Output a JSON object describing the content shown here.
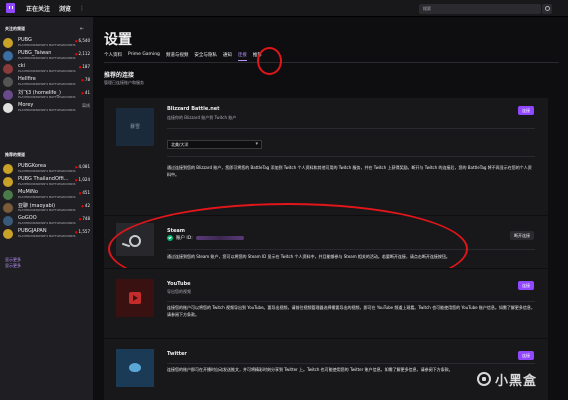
{
  "topbar": {
    "nav": [
      "正在关注",
      "浏览"
    ],
    "more_icon": "more-icon",
    "search_placeholder": "搜索"
  },
  "sidebar": {
    "followed_heading": "关注的频道",
    "recommended_heading": "推荐的频道",
    "followed": [
      {
        "name": "PUBG",
        "game": "PLAYERUNKNOWN'S BATTLEGROUNDS",
        "viewers": "6,540",
        "live": true,
        "color": "#c9a227"
      },
      {
        "name": "PUBG_Taiwan",
        "game": "PLAYERUNKNOWN'S BATTLEGROUNDS",
        "viewers": "2,112",
        "live": true,
        "color": "#3a6ea5"
      },
      {
        "name": "cki",
        "game": "PLAYERUNKNOWN'S BATTLEGROUNDS",
        "viewers": "187",
        "live": true,
        "color": "#8a3a3a"
      },
      {
        "name": "Hellfire",
        "game": "PLAYERUNKNOWN'S BATTLEGROUNDS",
        "viewers": "78",
        "live": true,
        "color": "#555555"
      },
      {
        "name": "刘飞3 (homelife_)",
        "game": "PLAYERUNKNOWN'S BATTLEGROUNDS",
        "viewers": "41",
        "live": true,
        "color": "#6a4a8a"
      },
      {
        "name": "Morey",
        "game": "PLAYERUNKNOWN'S BATTLEGROUNDS",
        "viewers": "离线",
        "live": false,
        "color": "#e0e0e0"
      }
    ],
    "recommended": [
      {
        "name": "PUBGKorea",
        "game": "PLAYERUNKNOWN'S BATTLEGROUNDS",
        "viewers": "4,081",
        "live": true,
        "color": "#c9a227"
      },
      {
        "name": "PUBG ThailandOffi...",
        "game": "PLAYERUNKNOWN'S BATTLEGROUNDS",
        "viewers": "1,024",
        "live": true,
        "color": "#c9a227"
      },
      {
        "name": "MuMiNo",
        "game": "PLAYERUNKNOWN'S BATTLEGROUNDS",
        "viewers": "451",
        "live": true,
        "color": "#4a7a4a"
      },
      {
        "name": "亚聊 (maoyabi)",
        "game": "PLAYERUNKNOWN'S BATTLEGROUNDS",
        "viewers": "42",
        "live": true,
        "color": "#7a5a3a"
      },
      {
        "name": "GoGOO",
        "game": "PLAYERUNKNOWN'S BATTLEGROUNDS",
        "viewers": "748",
        "live": true,
        "color": "#3a5a7a"
      },
      {
        "name": "PUBGJAPAN",
        "game": "PLAYERUNKNOWN'S BATTLEGROUNDS",
        "viewers": "1,557",
        "live": true,
        "color": "#c9a227"
      }
    ],
    "show_more": "显示更多",
    "show_more_2": "显示更多"
  },
  "main": {
    "title": "设置",
    "tabs": [
      "个人资料",
      "Prime Gaming",
      "频道与视频",
      "安全与隐私",
      "通知",
      "连接",
      "推荐"
    ],
    "active_tab_index": 5,
    "section_title": "推荐的连接",
    "section_sub": "管理已连接账户和服务",
    "cards": {
      "battlenet": {
        "logo_text": "暴雪",
        "title": "Blizzard Battle.net",
        "desc": "连接你的 Blizzard 账户到 Twitch 账户",
        "button": "连接",
        "region": "北美/大洋",
        "body": "通过连接到您的 Blizzard 账户，您即可将您的 BattleTag 添加到 Twitch 个人资料和其他可用的 Twitch 服务，并在 Twitch 上获得奖励。断开与 Twitch 的连接后，您的 BattleTag 将不再显示在您的个人资料中。"
      },
      "steam": {
        "title": "Steam",
        "status": "账户 ID:",
        "button": "断开连接",
        "body": "通过连接到您的 Steam 账户，您可以将您的 Steam ID 显示在 Twitch 个人资料中，并且能够参与 Steam 相关的活动。若要断开连接，请点击断开连接按钮。"
      },
      "youtube": {
        "title": "YouTube",
        "desc": "导出您的视频",
        "button": "连接",
        "body": "连接您的账户可以将您的 Twitch 视频导出到 YouTube。要导出视频，请前往视频管理器选择需要导出的视频，即可在 YouTube 频道上观看。Twitch 也可能使用您的 YouTube 账户信息。如需了解更多信息，请参阅下方条款。"
      },
      "twitter": {
        "title": "Twitter",
        "button": "连接",
        "body": "连接您的账户即可在开播时自动发送推文，并可将精彩时刻分享到 Twitter 上。Twitch 也可能使用您的 Twitter 账户信息。如需了解更多信息，请参阅下方条款。"
      }
    }
  },
  "watermark": {
    "text": "小黑盒"
  },
  "colors": {
    "accent": "#9147ff",
    "accent_text": "#bf94ff",
    "live": "#eb0400",
    "annotation": "#e0161a"
  }
}
